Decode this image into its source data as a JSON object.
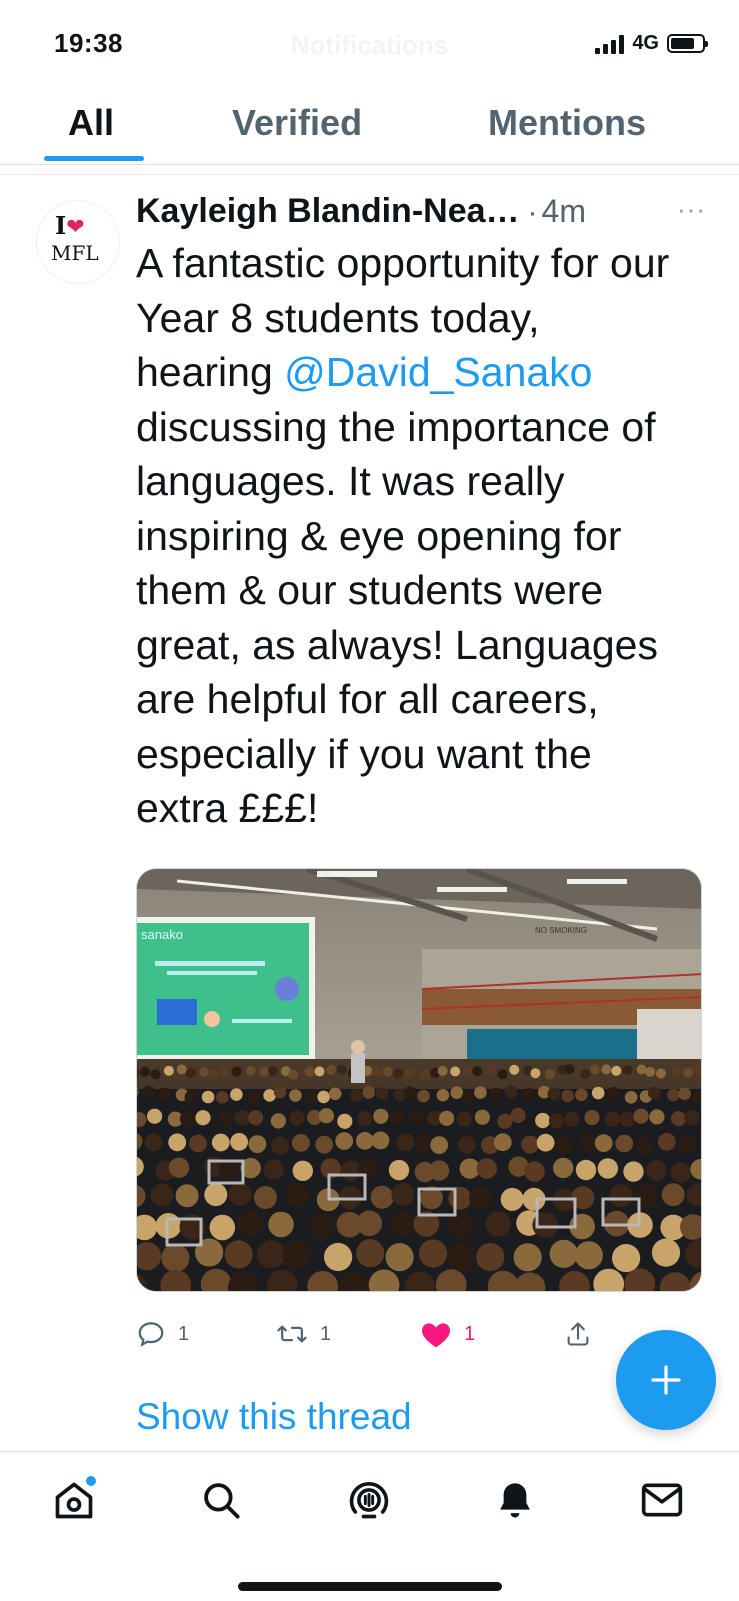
{
  "status_bar": {
    "time": "19:38",
    "header_title": "Notifications",
    "network": "4G",
    "battery_level": 0.75
  },
  "tabs": [
    {
      "label": "All",
      "active": true
    },
    {
      "label": "Verified",
      "active": false
    },
    {
      "label": "Mentions",
      "active": false
    }
  ],
  "tweet": {
    "avatar": {
      "line1": "I",
      "line2": "MFL",
      "icon": "heart-icon"
    },
    "author": "Kayleigh Blandin-Nea…",
    "separator": "·",
    "time": "4m",
    "more": "···",
    "text_before": "A fantastic opportunity for our Year 8 students today, hearing ",
    "mention": "@David_Sanako",
    "text_after": " discussing the importance of languages. It was really inspiring & eye opening for them & our students were great, as always! Languages are helpful for all careers, especially if you want the extra £££!",
    "media": {
      "screen_brand": "sanako",
      "balcony_sign": "NO SMOKING"
    },
    "actions": {
      "reply_count": "1",
      "retweet_count": "1",
      "like_count": "1",
      "liked": true
    },
    "show_thread": "Show this thread"
  },
  "colors": {
    "accent": "#1d9bf0",
    "like": "#f91880",
    "text": "#0f1419",
    "muted": "#536471"
  },
  "bottom_nav": [
    {
      "icon": "home-icon",
      "notification_dot": true
    },
    {
      "icon": "search-icon"
    },
    {
      "icon": "spaces-icon"
    },
    {
      "icon": "bell-icon"
    },
    {
      "icon": "mail-icon"
    }
  ]
}
